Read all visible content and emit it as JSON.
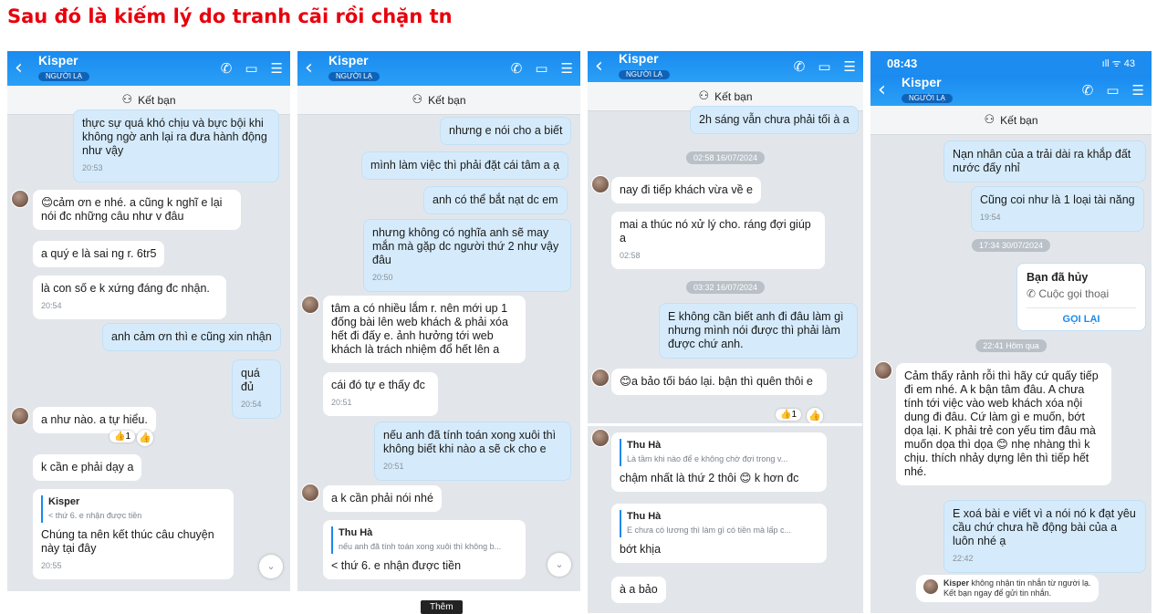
{
  "headline": "Sau đó là kiếm lý do tranh cãi rồi chặn tn",
  "contact": {
    "name": "Kisper",
    "tag": "NGƯỜI LẠ"
  },
  "add_friend_label": "Kết bạn",
  "icons": {
    "back": "back-chevron-icon",
    "call": "phone-icon",
    "video": "video-icon",
    "menu": "list-menu-icon",
    "add_friend": "add-friend-icon"
  },
  "colors": {
    "header": "#1a8af0",
    "out_bubble": "#d5ebfb",
    "in_bubble": "#ffffff",
    "chat_bg": "#e2e6ea",
    "headline": "#e8000b"
  },
  "panel1": {
    "messages": [
      {
        "text": "thực sự quá khó chịu và bực bội khi không ngờ anh lại ra đưa hành động như vậy",
        "time": "20:53"
      },
      {
        "text": "😊cảm ơn e nhé. a cũng k nghĩ e lại nói đc những câu như v đâu"
      },
      {
        "text": "a quý e là sai ng r. 6tr5"
      },
      {
        "text": "là con số e k xứng đáng đc nhận.",
        "time": "20:54"
      },
      {
        "text": "anh cảm ơn thì e cũng xin nhận"
      },
      {
        "text": "quá đủ",
        "time": "20:54"
      },
      {
        "text": "a như nào. a tự hiểu."
      },
      {
        "text": "k cần e phải dạy a"
      },
      {
        "quote_name": "Kisper",
        "quote_text": "< thứ 6. e nhận được tiền",
        "text": "Chúng ta nên kết thúc câu chuyện này tại đây",
        "time": "20:55"
      }
    ],
    "reaction": "👍1"
  },
  "panel2": {
    "messages": [
      {
        "text": "nhưng e nói cho a biết"
      },
      {
        "text": "mình làm việc thì phải đặt cái tâm a ạ"
      },
      {
        "text": "anh có thể bắt nạt dc em"
      },
      {
        "text": "nhưng không có nghĩa anh sẽ may mắn mà gặp dc người thứ 2 như vậy đâu",
        "time": "20:50"
      },
      {
        "text": "tâm a có nhiều lắm r. nên mới up 1 đống bài lên web khách & phải xóa hết đi đấy e. ảnh hưởng tới web khách là trách nhiệm đổ hết lên a"
      },
      {
        "text": "cái đó tự e thấy đc",
        "time": "20:51"
      },
      {
        "text": "nếu anh đã tính toán xong xuôi thì không biết khi nào a sẽ ck cho e",
        "time": "20:51"
      },
      {
        "text": "a k cần phải nói nhé"
      },
      {
        "quote_name": "Thu Hà",
        "quote_text": "nếu anh đã tính toán xong xuôi thì không b...",
        "text": "< thứ 6. e nhận được tiền"
      }
    ],
    "tooltip": "Thêm"
  },
  "panel3": {
    "messages": [
      {
        "text": "2h sáng vẫn chưa phải tối à a"
      },
      {
        "stamp": "02:58 16/07/2024"
      },
      {
        "text": "nay đi tiếp khách vừa về e"
      },
      {
        "text": "mai a thúc nó xử lý cho. ráng đợi giúp a",
        "time": "02:58"
      },
      {
        "stamp": "03:32 16/07/2024"
      },
      {
        "text": "E không cần biết anh đi đâu làm gì nhưng mình nói được thì phải làm được chứ anh."
      },
      {
        "text": "😊a bảo tối báo lại. bận thì quên thôi e"
      },
      {
        "quote_name": "Thu Hà",
        "quote_text": "Là tầm khi nào để e không chờ đợi trong v...",
        "text": "chậm nhất là thứ 2 thôi 😊 k hơn đc"
      },
      {
        "quote_name": "Thu Hà",
        "quote_text": "E chưa có lương thì làm gì có tiền mà lấp c...",
        "text": "bớt khịa"
      },
      {
        "text": "à a bảo"
      }
    ],
    "reaction": "👍1"
  },
  "panel4": {
    "status_time": "08:43",
    "status_right": "ıll ᯤ 43",
    "messages": [
      {
        "text": "Nạn nhân của a trải dài ra khắp đất nước đấy nhỉ"
      },
      {
        "text": "Cũng coi như là 1 loại tài năng",
        "time": "19:54"
      },
      {
        "stamp": "17:34 30/07/2024"
      },
      {
        "stamp": "22:41 Hôm qua"
      },
      {
        "text": "Cảm thấy rảnh rỗi thì hãy cứ quấy tiếp đi em nhé. A k bận tâm đâu. A chưa tính tới việc vào web khách xóa nội dung đi đâu. Cứ làm gì e muốn, bớt dọa lại. K phải trẻ con yếu tim đâu mà muốn dọa thì dọa 😊 nhẹ nhàng thì k chịu. thích nhảy dựng lên thì tiếp hết nhé."
      },
      {
        "text": "E xoá bài e viết vì a nói nó k đạt yêu cầu chứ chưa hề động bài của a luôn nhé ạ",
        "time": "22:42"
      }
    ],
    "call": {
      "title": "Bạn đã hủy",
      "subtitle": "Cuộc gọi thoại",
      "button": "GỌI LẠI"
    },
    "notice": {
      "name": "Kisper",
      "line1": " không nhận tin nhắn từ người lạ.",
      "line2": "Kết bạn ngay để gửi tin nhắn."
    }
  }
}
